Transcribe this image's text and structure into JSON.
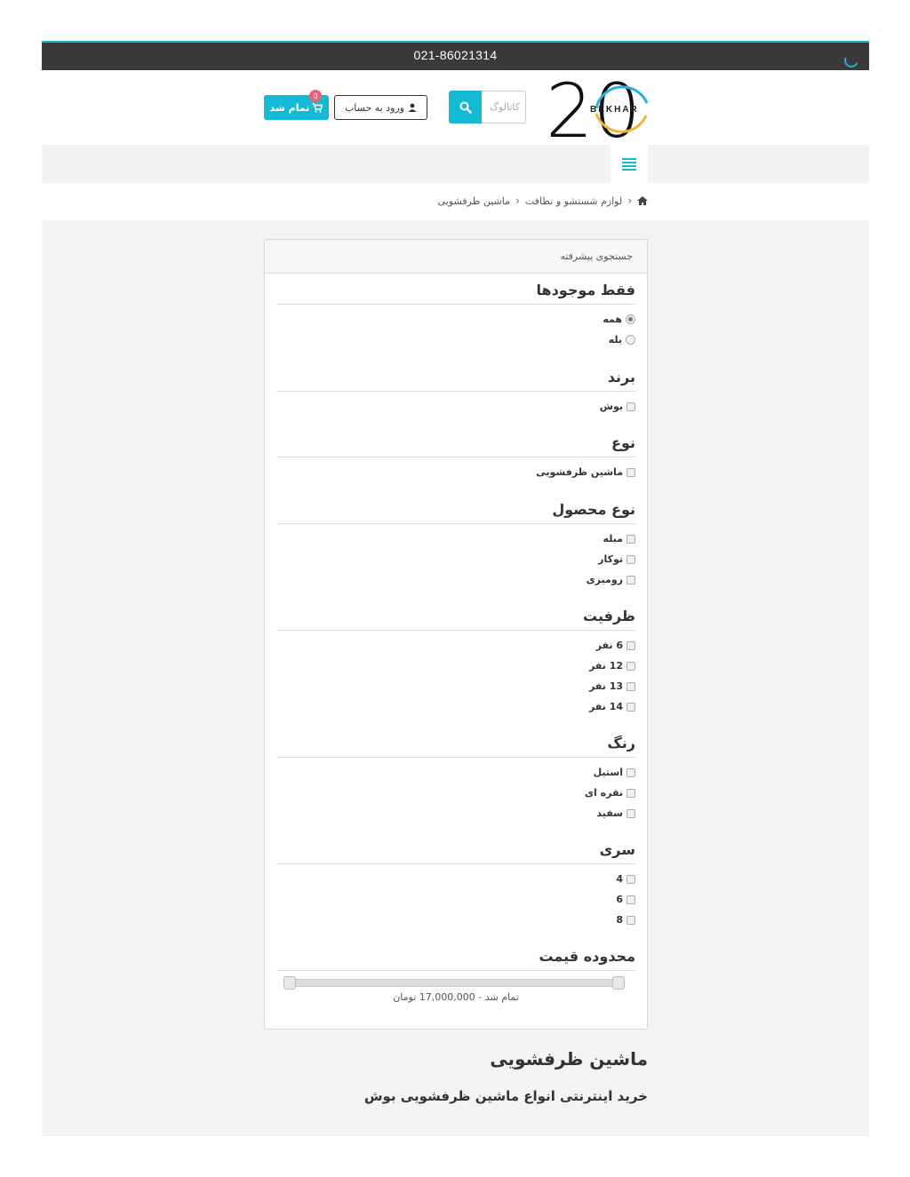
{
  "header": {
    "phone": "021-86021314",
    "logo_text": "BEKHAR",
    "logo_number": "20",
    "search_placeholder": "کاتالوگ",
    "login_label": "ورود به حساب",
    "cart_label": "تمام شد",
    "cart_count": "0"
  },
  "breadcrumb": {
    "items": [
      "لوازم شستشو و نظافت",
      "ماشین ظرفشویی"
    ]
  },
  "filters": {
    "panel_title": "جستجوی پیشرفته",
    "stock": {
      "title": "فقط موجودها",
      "options": [
        "همه",
        "بله"
      ],
      "selected": "همه"
    },
    "brand": {
      "title": "برند",
      "options": [
        "بوش"
      ]
    },
    "type": {
      "title": "نوع",
      "options": [
        "ماشین ظرفشویی"
      ]
    },
    "product_type": {
      "title": "نوع محصول",
      "options": [
        "مبله",
        "توکار",
        "رومیزی"
      ]
    },
    "capacity": {
      "title": "ظرفیت",
      "options": [
        "6 نفر",
        "12 نفر",
        "13 نفر",
        "14 نفر"
      ]
    },
    "color": {
      "title": "رنگ",
      "options": [
        "استیل",
        "نقره ای",
        "سفید"
      ]
    },
    "series": {
      "title": "سری",
      "options": [
        "4",
        "6",
        "8"
      ]
    },
    "price": {
      "title": "محدوده قیمت",
      "range_text": "تمام شد - 17,000,000 تومان"
    }
  },
  "category": {
    "title": "ماشین ظرفشویی",
    "description": "خرید اینترنتی انواع ماشین ظرفشویی بوش"
  },
  "colors": {
    "accent": "#14bad3",
    "topbar": "#3a3a3a",
    "badge": "#e8627a"
  }
}
